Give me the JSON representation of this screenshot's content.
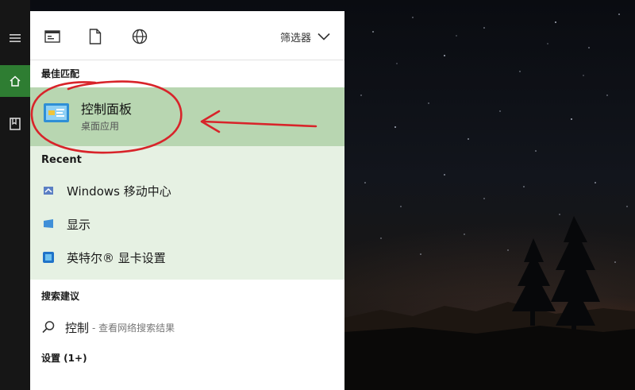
{
  "toolbar": {
    "icons": [
      "apps-icon",
      "document-icon",
      "web-icon"
    ],
    "filter_label": "筛选器"
  },
  "best_match": {
    "section_label": "最佳匹配",
    "title": "控制面板",
    "subtitle": "桌面应用"
  },
  "recent": {
    "section_label": "Recent",
    "items": [
      {
        "label": "Windows 移动中心",
        "icon": "mobility-center-icon"
      },
      {
        "label": "显示",
        "icon": "display-icon"
      },
      {
        "label": "英特尔® 显卡设置",
        "icon": "intel-graphics-icon"
      }
    ]
  },
  "suggestions": {
    "section_label": "搜索建议",
    "query": "控制",
    "hint": "- 查看网络搜索结果"
  },
  "settings": {
    "section_label": "设置 (1+)"
  },
  "colors": {
    "best_match_bg": "#b8d6b1",
    "recent_bg": "#e6f1e3",
    "strip_active": "#2e7d32",
    "annotation": "#d8242a"
  }
}
